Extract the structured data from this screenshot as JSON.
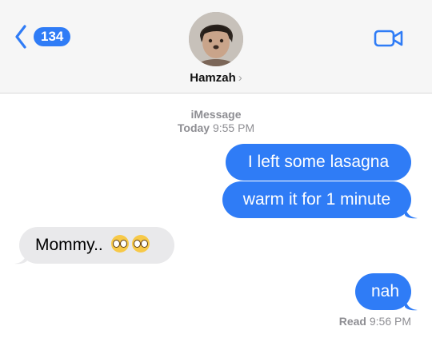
{
  "header": {
    "back_badge_count": "134",
    "contact_name": "Hamzah",
    "contact_chevron": "›",
    "icons": {
      "back": "chevron-left-icon",
      "video": "video-camera-icon",
      "avatar": "avatar-photo"
    },
    "accent_color": "#2f7cf6"
  },
  "conversation": {
    "service_label": "iMessage",
    "timestamp_day": "Today",
    "timestamp_time": "9:55 PM",
    "messages": [
      {
        "direction": "sent",
        "text": "I left some lasagna"
      },
      {
        "direction": "sent",
        "text": "warm it for 1 minute"
      },
      {
        "direction": "received",
        "text": "Mommy..",
        "emoji": [
          "pleading-face-emoji",
          "pleading-face-emoji"
        ]
      },
      {
        "direction": "sent",
        "text": "nah"
      }
    ],
    "read_receipt": {
      "label": "Read",
      "time": "9:56 PM"
    }
  }
}
